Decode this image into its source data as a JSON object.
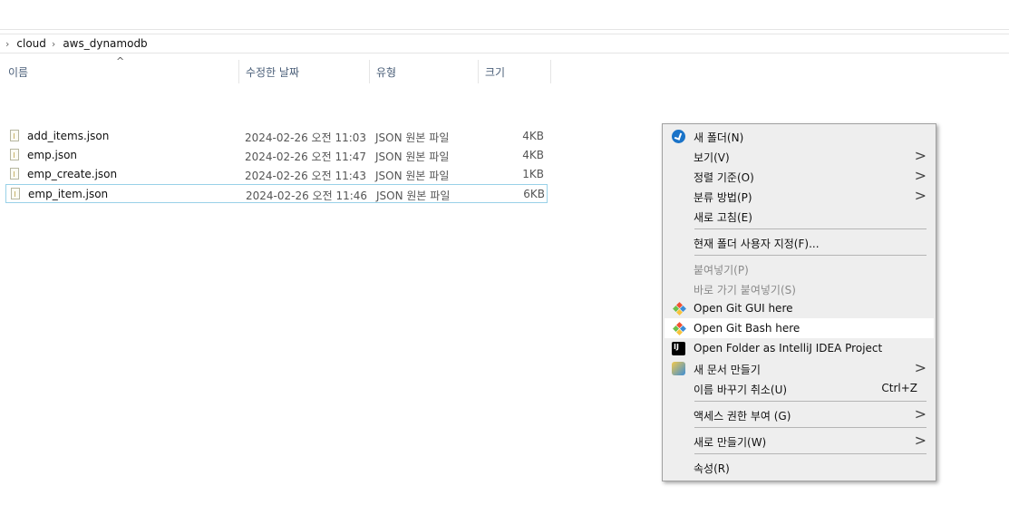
{
  "breadcrumb": [
    "cloud",
    "aws_dynamodb"
  ],
  "columns": {
    "name": "이름",
    "modified": "수정한 날짜",
    "type": "유형",
    "size": "크기",
    "sort_indicator": "^"
  },
  "files": [
    {
      "name": "add_items.json",
      "date": "2024-02-26 오전 11:03",
      "type": "JSON 원본 파일",
      "size": "4KB"
    },
    {
      "name": "emp.json",
      "date": "2024-02-26 오전 11:47",
      "type": "JSON 원본 파일",
      "size": "4KB"
    },
    {
      "name": "emp_create.json",
      "date": "2024-02-26 오전 11:43",
      "type": "JSON 원본 파일",
      "size": "1KB"
    },
    {
      "name": "emp_item.json",
      "date": "2024-02-26 오전 11:46",
      "type": "JSON 원본 파일",
      "size": "6KB"
    }
  ],
  "context_menu": {
    "new_folder": "새 폴더(N)",
    "view": "보기(V)",
    "sort_by": "정렬 기준(O)",
    "group_by": "분류 방법(P)",
    "refresh": "새로 고침(E)",
    "customize_folder": "현재 폴더 사용자 지정(F)...",
    "paste": "붙여넣기(P)",
    "paste_shortcut": "바로 가기 붙여넣기(S)",
    "git_gui": "Open Git GUI here",
    "git_bash": "Open Git Bash here",
    "intellij": "Open Folder as IntelliJ IDEA Project",
    "new_document": "새 문서 만들기",
    "undo_rename": "이름 바꾸기 취소(U)",
    "undo_shortcut": "Ctrl+Z",
    "give_access": "액세스 권한 부여 (G)",
    "new": "새로 만들기(W)",
    "properties": "속성(R)"
  },
  "icons": {
    "submenu_arrow": ">",
    "crumb_separator": "›"
  },
  "colors": {
    "selection_border": "#99d1e8",
    "menu_background": "#eeeeee",
    "menu_hover": "#ffffff",
    "header_text": "#4c607a"
  }
}
